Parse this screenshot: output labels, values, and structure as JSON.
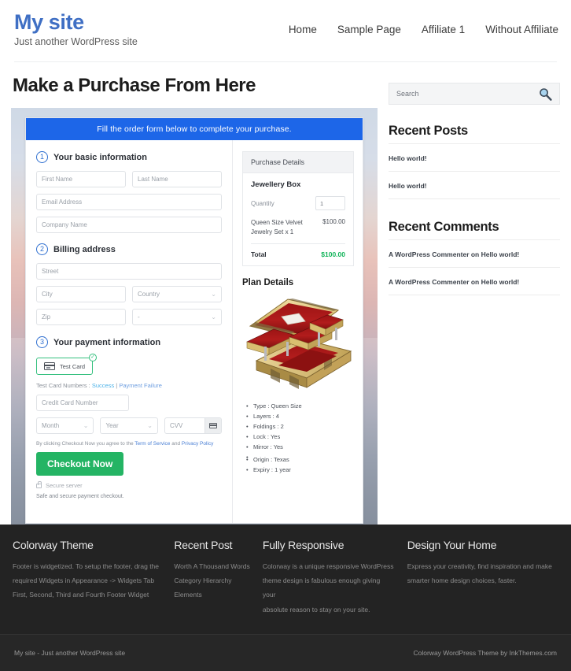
{
  "header": {
    "brand_title": "My site",
    "brand_tagline": "Just another WordPress site",
    "nav": [
      {
        "label": "Home"
      },
      {
        "label": "Sample Page"
      },
      {
        "label": "Affiliate 1"
      },
      {
        "label": "Without Affiliate"
      }
    ]
  },
  "main": {
    "page_title": "Make a Purchase From Here",
    "banner": "Fill the order form below to complete your purchase.",
    "steps": {
      "step1_num": "1",
      "step1_label": "Your basic information",
      "step2_num": "2",
      "step2_label": "Billing address",
      "step3_num": "3",
      "step3_label": "Your payment information"
    },
    "fields": {
      "first_name": "First Name",
      "last_name": "Last Name",
      "email": "Email Address",
      "company": "Company Name",
      "street": "Street",
      "city": "City",
      "country": "Country",
      "zip": "Zip",
      "state": "-",
      "credit_card": "Credit Card Number",
      "month": "Month",
      "year": "Year",
      "cvv": "CVV"
    },
    "payment": {
      "test_card_label": "Test  Card",
      "test_numbers_prefix": "Test Card Numbers : ",
      "test_success": "Success",
      "test_separator": " | ",
      "test_failure": "Payment Failure",
      "terms_prefix": "By clicking Checkout Now you agree to the ",
      "terms_link": "Term of Service",
      "terms_and": " and ",
      "privacy_link": "Privacy Policy",
      "checkout_label": "Checkout Now",
      "secure_server": "Secure server",
      "safe_text": "Safe and secure payment checkout."
    }
  },
  "purchase_details": {
    "heading": "Purchase Details",
    "product": "Jewellery Box",
    "quantity_label": "Quantity",
    "quantity_value": "1",
    "line_item_name": "Queen Size Velvet Jewelry Set x 1",
    "line_item_price": "$100.00",
    "total_label": "Total",
    "total_value": "$100.00",
    "total_color": "#12b45a"
  },
  "plan": {
    "title": "Plan Details",
    "items": [
      "Type : Queen Size",
      "Layers : 4",
      "Foldings : 2",
      "Lock : Yes",
      "Mirror : Yes",
      "Origin : Texas",
      "Expiry : 1 year"
    ]
  },
  "sidebar": {
    "search_placeholder": "Search",
    "recent_posts_heading": "Recent Posts",
    "recent_posts": [
      {
        "label": "Hello world!"
      },
      {
        "label": "Hello world!"
      }
    ],
    "recent_comments_heading": "Recent Comments",
    "recent_comments": [
      {
        "label": "A WordPress Commenter on Hello world!"
      },
      {
        "label": "A WordPress Commenter on Hello world!"
      }
    ]
  },
  "footer": {
    "columns": [
      {
        "heading": "Colorway Theme",
        "lines": [
          "Footer is widgetized. To setup the footer, drag the",
          "required Widgets in Appearance -> Widgets Tab",
          "First, Second, Third and Fourth Footer Widget"
        ]
      },
      {
        "heading": "Recent Post",
        "lines": [
          "Worth A Thousand Words",
          "Category Hierarchy",
          "Elements"
        ]
      },
      {
        "heading": "Fully Responsive",
        "lines": [
          "Colorway is a unique responsive WordPress",
          "theme design is fabulous enough giving your",
          "absolute reason to stay on your site."
        ]
      },
      {
        "heading": "Design Your Home",
        "lines": [
          "Express your creativity, find inspiration and make",
          "smarter home design choices, faster."
        ]
      }
    ],
    "bottom_left": "My site - Just another WordPress site",
    "bottom_right": "Colorway WordPress Theme by InkThemes.com"
  },
  "colors": {
    "brand_blue": "#3f6fc4",
    "banner_blue": "#1d66e8",
    "success_green": "#24b464",
    "total_green": "#12b45a"
  }
}
